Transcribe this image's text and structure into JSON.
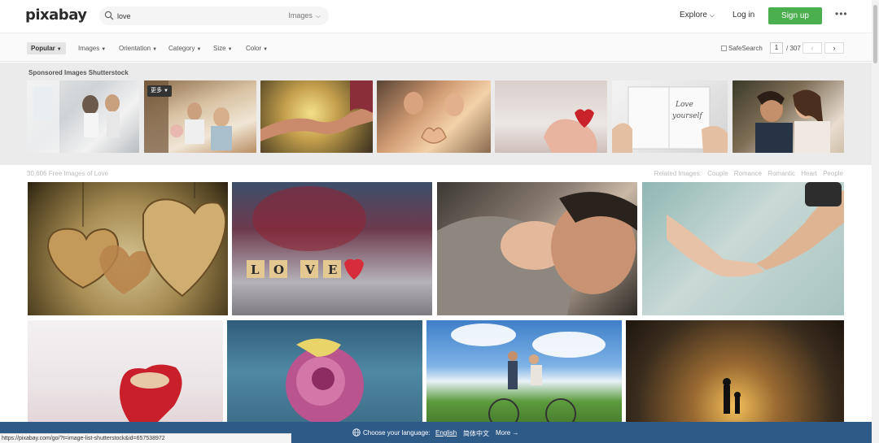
{
  "header": {
    "logo": "pixabay",
    "search_value": "love",
    "search_type": "Images",
    "explore": "Explore",
    "login": "Log in",
    "signup": "Sign up",
    "more": "•••"
  },
  "filters": {
    "popular": "Popular",
    "images": "Images",
    "orientation": "Orientation",
    "category": "Category",
    "size": "Size",
    "color": "Color",
    "safesearch": "SafeSearch",
    "page": "1",
    "page_total": "/ 307",
    "prev": "‹",
    "next": "›"
  },
  "sponsored": {
    "label": "Sponsored Images Shutterstock",
    "badge": "更多"
  },
  "results": {
    "count": "30,606 Free Images of Love",
    "related_label": "Related Images:",
    "related": [
      "Couple",
      "Romance",
      "Romantic",
      "Heart",
      "People"
    ]
  },
  "langbar": {
    "prompt": "Choose your language:",
    "english": "English",
    "chinese": "简体中文",
    "more": "More →"
  },
  "status_url": "https://pixabay.com/go/?t=image-list-shutterstock&id=657538972",
  "colors": {
    "accent_green": "#4bae4f",
    "lang_bar": "#2e5a88"
  }
}
